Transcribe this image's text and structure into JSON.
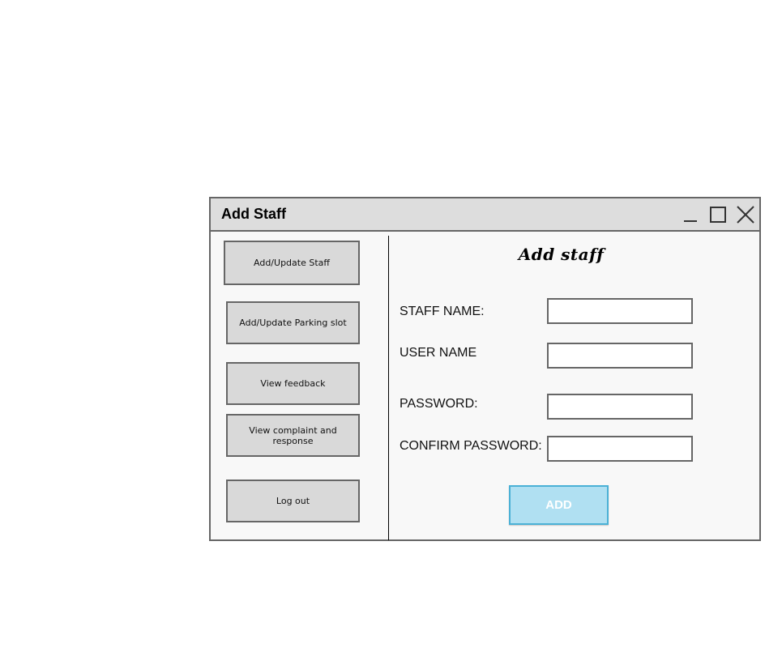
{
  "window": {
    "title": "Add Staff"
  },
  "sidebar": {
    "items": [
      {
        "label": "Add/Update Staff"
      },
      {
        "label": "Add/Update Parking slot"
      },
      {
        "label": "View feedback"
      },
      {
        "label": "View complaint and response"
      },
      {
        "label": "Log out"
      }
    ]
  },
  "form": {
    "title": "Add staff",
    "fields": [
      {
        "label": "STAFF NAME:",
        "value": ""
      },
      {
        "label": "USER NAME",
        "value": ""
      },
      {
        "label": "PASSWORD:",
        "value": ""
      },
      {
        "label": "CONFIRM PASSWORD:",
        "value": ""
      }
    ],
    "submit_label": "ADD"
  },
  "icons": {
    "minimize": "minimize-icon",
    "maximize": "maximize-icon",
    "close": "close-icon"
  },
  "colors": {
    "titlebar": "#dddddd",
    "border": "#666666",
    "button_bg": "#d9d9d9",
    "add_button_bg": "#b0e0f2",
    "add_button_border": "#4bb1d6"
  }
}
